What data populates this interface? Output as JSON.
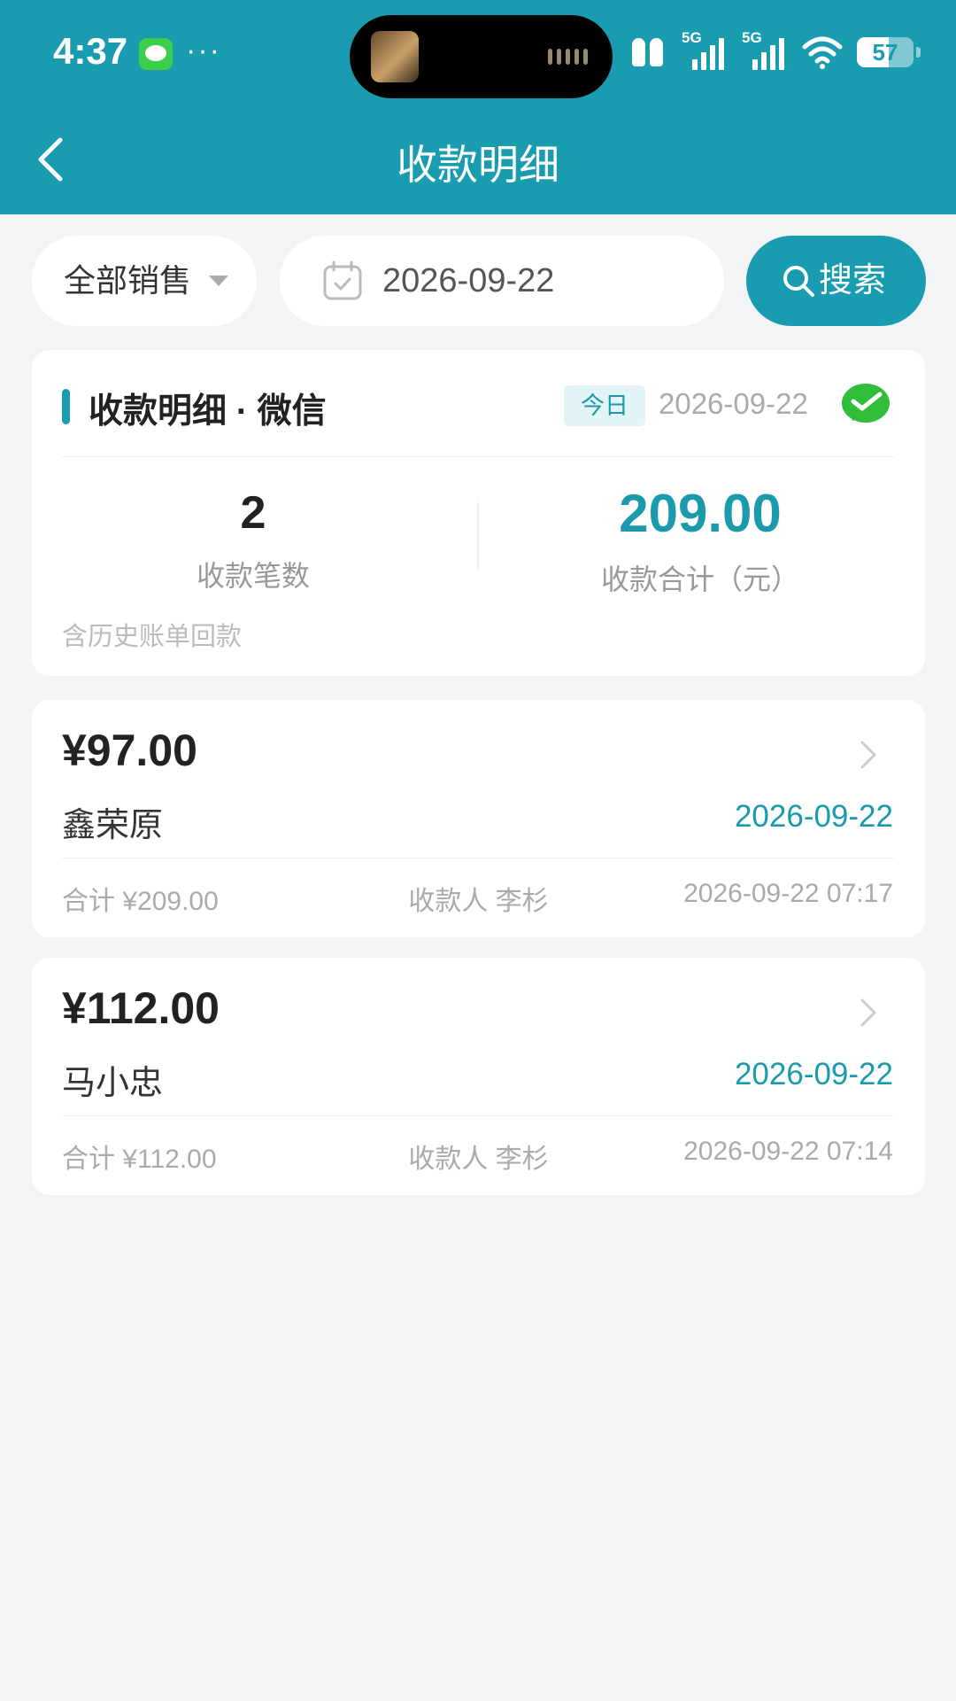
{
  "status_bar": {
    "time": "4:37",
    "dots": "···",
    "network_left": "5G",
    "network_right": "5G",
    "battery": "57"
  },
  "nav": {
    "title": "收款明细"
  },
  "filters": {
    "seller_select": "全部销售",
    "date": "2026-09-22",
    "search_label": "搜索"
  },
  "summary": {
    "title": "收款明细 · 微信",
    "today_badge": "今日",
    "date": "2026-09-22",
    "count": "2",
    "count_label": "收款笔数",
    "total": "209.00",
    "total_label": "收款合计（元）",
    "note": "含历史账单回款"
  },
  "payments": [
    {
      "amount": "¥97.00",
      "customer": "鑫荣原",
      "date": "2026-09-22",
      "total": "合计 ¥209.00",
      "payee": "收款人 李杉",
      "time": "2026-09-22 07:17"
    },
    {
      "amount": "¥112.00",
      "customer": "马小忠",
      "date": "2026-09-22",
      "total": "合计 ¥112.00",
      "payee": "收款人 李杉",
      "time": "2026-09-22 07:14"
    }
  ],
  "colors": {
    "brand": "#1a9cb0",
    "accent_text": "#1a9aaa",
    "background": "#f3f4f6"
  }
}
